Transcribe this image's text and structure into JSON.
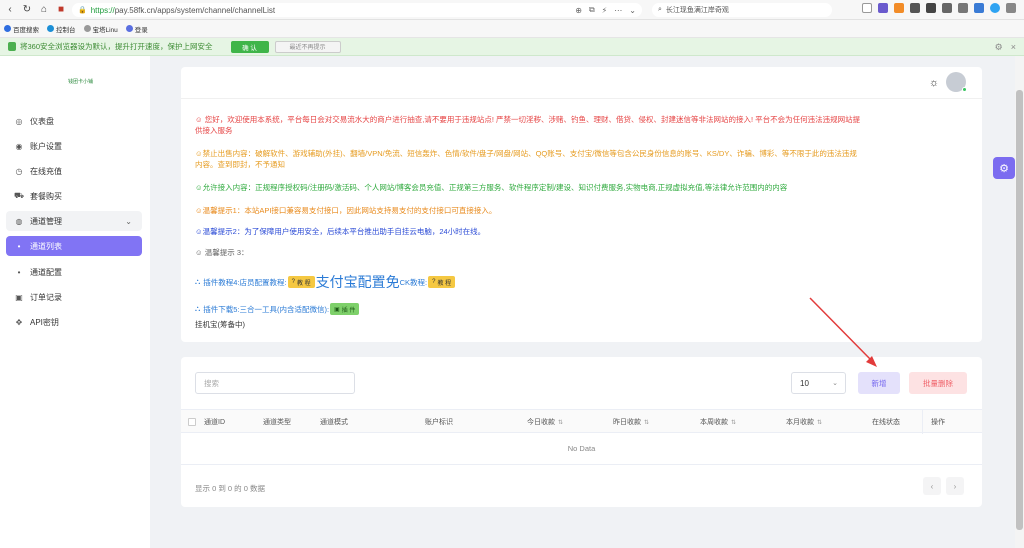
{
  "browser": {
    "url_https": "https://",
    "url_rest": "pay.58fk.cn/apps/system/channel/channelList",
    "search_text": "长江现鱼满江岸奇观",
    "bookmarks": [
      "百度搜索",
      "控制台",
      "宝塔Linu",
      "登录"
    ]
  },
  "notice": {
    "text": "将360安全浏览器设为默认，提升打开速度，保护上网安全",
    "ok": "确 认",
    "no": "最近不再提示"
  },
  "sidebar": {
    "logo": "钱团卡小铺",
    "items": [
      {
        "label": "仪表盘",
        "icon": "dashboard-icon",
        "glyph": "◎"
      },
      {
        "label": "账户设置",
        "icon": "account-icon",
        "glyph": "◉"
      },
      {
        "label": "在线充值",
        "icon": "recharge-icon",
        "glyph": "◷"
      },
      {
        "label": "套餐购买",
        "icon": "cart-icon",
        "glyph": "⛟"
      },
      {
        "label": "通道管理",
        "icon": "channel-icon",
        "glyph": "◍"
      },
      {
        "label": "通道列表",
        "icon": "dot-icon",
        "glyph": "•"
      },
      {
        "label": "通道配置",
        "icon": "dot-icon",
        "glyph": "•"
      },
      {
        "label": "订单记录",
        "icon": "order-icon",
        "glyph": "▣"
      },
      {
        "label": "API密钥",
        "icon": "key-icon",
        "glyph": "✥"
      }
    ]
  },
  "announce": {
    "l1": "☺ 您好，欢迎使用本系统，平台每日会对交易流水大的商户进行抽查,请不要用于违规站点! 严禁一切淫秽、涉赌、钓鱼、理财、借贷、侵权、封建迷信等非法网站的接入! 平台不会为任何违法违规网站提",
    "l1b": "供接入服务",
    "l2": "☺禁止出售内容：破解软件、游戏辅助(外挂)、翻墙/VPN/免流、短信轰炸、色情/软件/盘子/网盘/网站、QQ账号、支付宝/微信等包含公民身份信息的账号、KS/DY、诈骗、博彩、等不限于此的违法违规",
    "l2b": "内容。查到即封，不予通知",
    "l3": "☺允许接入内容：正规程序授权码/注册码/激活码、个人网站/博客会员充值、正规第三方服务、软件程序定制/建设、知识付费服务,实物电商,正规虚拟充值,等法律允许范围内的内容",
    "l4": "☺温馨提示1：本站API接口兼容易支付接口，因此网站支持易支付的支付接口可直接接入。",
    "l5": "☺温馨提示2：为了保障用户使用安全，后续本平台推出助手自挂云电脑，24小时在线。",
    "l6": "☺ 温馨提示 3：",
    "plugin1_a": "插件教程4:店员配置教程:",
    "tutorial": "教 程",
    "plugin1_big": "支付宝配置免",
    "plugin1_b": "CK教程:",
    "plugin2": "插件下载5:三合一工具(内含适配微信):",
    "plugin_label": "插 件",
    "plugin2_sub": "挂机宝(筹备中)"
  },
  "table": {
    "search_placeholder": "搜索",
    "page_size": "10",
    "add": "新增",
    "batch_delete": "批量删除",
    "headers": [
      "通道ID",
      "通道类型",
      "通道模式",
      "账户标识",
      "今日收款",
      "昨日收款",
      "本周收款",
      "本月收款",
      "在线状态",
      "操作"
    ],
    "empty": "No Data",
    "footer": "显示 0 到 0 的 0 数据"
  },
  "colors": {
    "accent": "#8174f4",
    "red_arrow": "#e23b3b"
  }
}
